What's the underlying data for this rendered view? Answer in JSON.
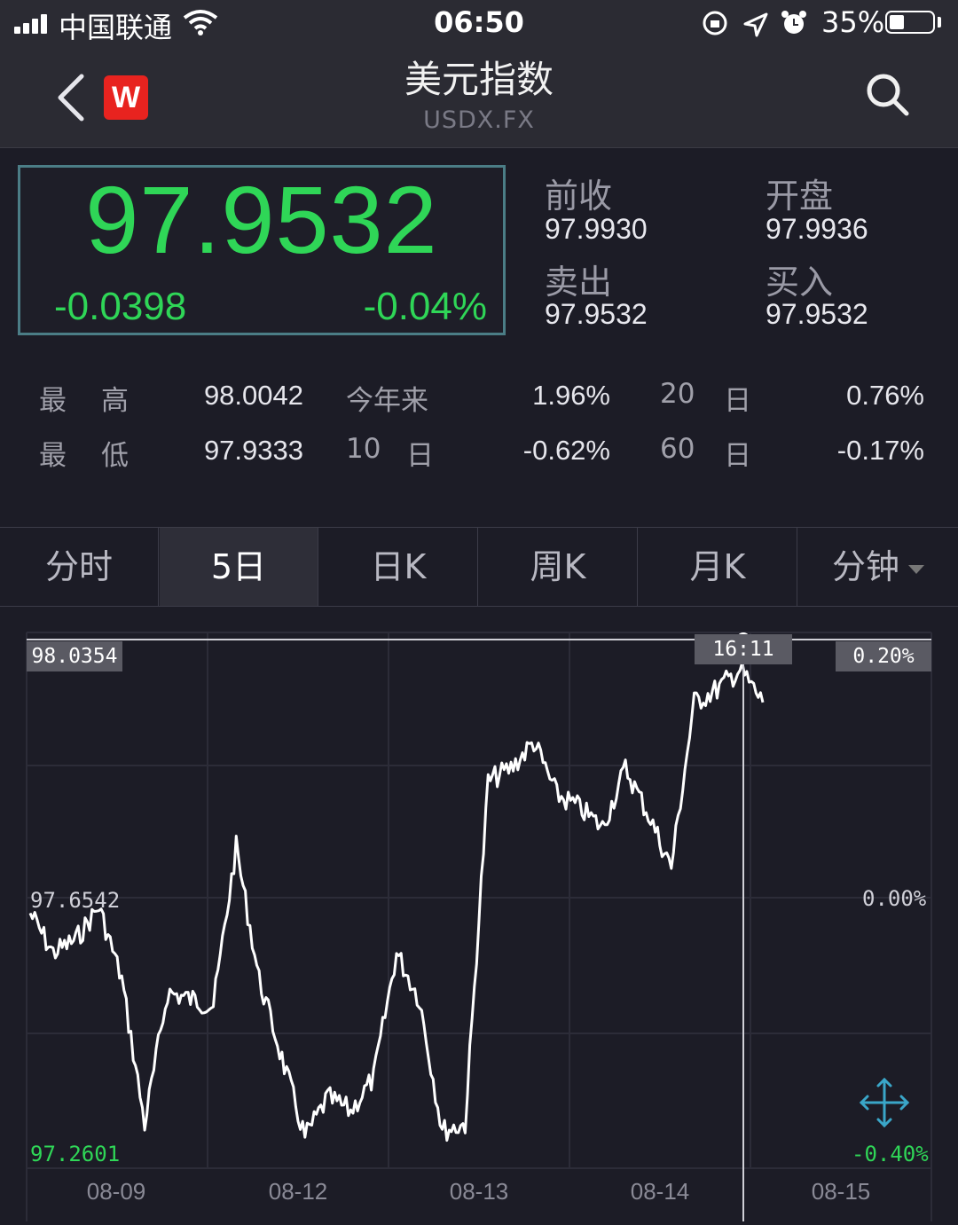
{
  "status_bar": {
    "carrier": "中国联通",
    "time": "06:50",
    "battery": "35%"
  },
  "header": {
    "title": "美元指数",
    "subtitle": "USDX.FX",
    "logo_text": "W"
  },
  "quote": {
    "price": "97.9532",
    "change": "-0.0398",
    "change_pct": "-0.04%",
    "prev_close_label": "前收",
    "prev_close": "97.9930",
    "open_label": "开盘",
    "open": "97.9936",
    "sell_label": "卖出",
    "sell": "97.9532",
    "buy_label": "买入",
    "buy": "97.9532"
  },
  "stats": {
    "high_label_1": "最",
    "high_label_2": "高",
    "high": "98.0042",
    "low_label_1": "最",
    "low_label_2": "低",
    "low": "97.9333",
    "ytd_label": "今年来",
    "ytd": "1.96%",
    "d10_num": "10",
    "d10_unit": "日",
    "d10": "-0.62%",
    "d20_num": "20",
    "d20_unit": "日",
    "d20": "0.76%",
    "d60_num": "60",
    "d60_unit": "日",
    "d60": "-0.17%"
  },
  "tabs": [
    {
      "label": "分时"
    },
    {
      "label": "5日"
    },
    {
      "label": "日K"
    },
    {
      "label": "周K"
    },
    {
      "label": "月K"
    },
    {
      "label": "分钟"
    }
  ],
  "chart": {
    "top_value": "98.0354",
    "top_pct": "0.20%",
    "mid_value": "97.6542",
    "mid_pct": "0.00%",
    "bottom_value": "97.2601",
    "bottom_pct": "-0.40%",
    "cursor_time": "16:11",
    "x_labels": [
      "08-09",
      "08-12",
      "08-13",
      "08-14",
      "08-15"
    ]
  },
  "colors": {
    "down": "#2fd657",
    "up": "#e8231f",
    "background": "#1c1c26"
  },
  "chart_data": {
    "type": "line",
    "x": [
      "08-09",
      "08-12",
      "08-13",
      "08-14",
      "08-15"
    ],
    "ylim": [
      97.2601,
      98.0354
    ],
    "series": [
      {
        "values": [
          97.62,
          97.56,
          97.58,
          97.63,
          97.52,
          97.3,
          97.5,
          97.49,
          97.48,
          97.72,
          97.52,
          97.4,
          97.28,
          97.34,
          97.32,
          97.37,
          97.56,
          97.49,
          97.29,
          97.3,
          97.82,
          97.84,
          97.88,
          97.8,
          97.78,
          97.75,
          97.84,
          97.77,
          97.69,
          97.94,
          97.96,
          97.99,
          97.94
        ]
      }
    ]
  }
}
